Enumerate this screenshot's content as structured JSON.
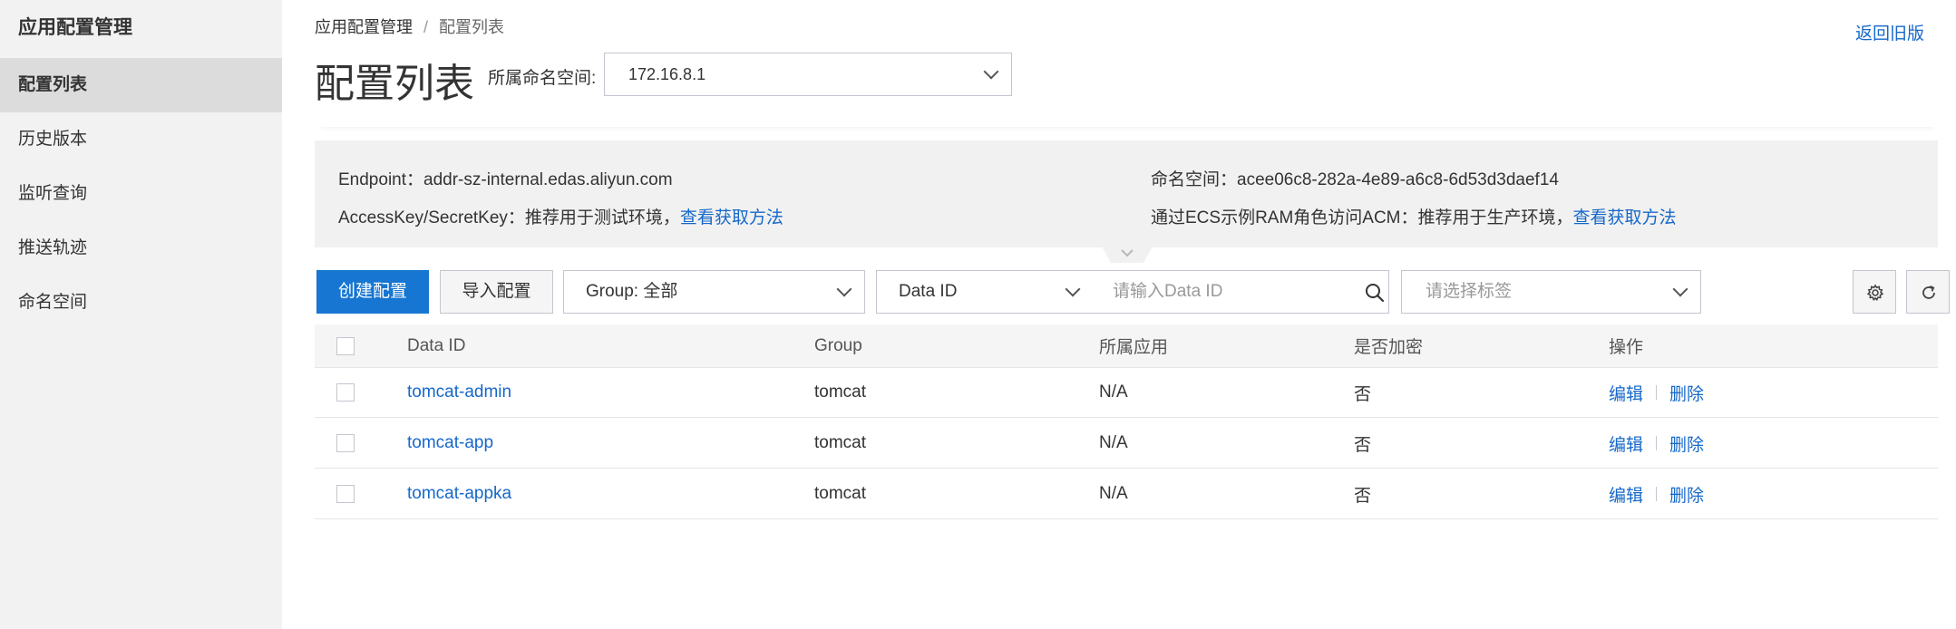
{
  "sidebar": {
    "title": "应用配置管理",
    "items": [
      {
        "label": "配置列表"
      },
      {
        "label": "历史版本"
      },
      {
        "label": "监听查询"
      },
      {
        "label": "推送轨迹"
      },
      {
        "label": "命名空间"
      }
    ]
  },
  "header": {
    "breadcrumb": {
      "root": "应用配置管理",
      "separator": "/",
      "current": "配置列表"
    },
    "back_link": "返回旧版",
    "title": "配置列表",
    "namespace_label": "所属命名空间:",
    "namespace_value": "172.16.8.1"
  },
  "info": {
    "endpoint": "Endpoint：addr-sz-internal.edas.aliyun.com",
    "namespace": "命名空间：acee06c8-282a-4e89-a6c8-6d53d3daef14",
    "accesskey_text": "AccessKey/SecretKey：推荐用于测试环境，",
    "accesskey_link": "查看获取方法",
    "ecs_text": "通过ECS示例RAM角色访问ACM：推荐用于生产环境，",
    "ecs_link": "查看获取方法"
  },
  "toolbar": {
    "create_label": "创建配置",
    "import_label": "导入配置",
    "group_select": "Group: 全部",
    "field_select": "Data ID",
    "search_placeholder": "请输入Data ID",
    "tag_placeholder": "请选择标签"
  },
  "table": {
    "columns": [
      "Data ID",
      "Group",
      "所属应用",
      "是否加密",
      "操作"
    ],
    "rows": [
      {
        "data_id": "tomcat-admin",
        "group": "tomcat",
        "app": "N/A",
        "encrypted": "否",
        "edit": "编辑",
        "delete": "删除"
      },
      {
        "data_id": "tomcat-app",
        "group": "tomcat",
        "app": "N/A",
        "encrypted": "否",
        "edit": "编辑",
        "delete": "删除"
      },
      {
        "data_id": "tomcat-appka",
        "group": "tomcat",
        "app": "N/A",
        "encrypted": "否",
        "edit": "编辑",
        "delete": "删除"
      }
    ]
  },
  "icons": {
    "search": "search-icon",
    "settings": "gear-icon",
    "refresh": "refresh-icon",
    "dropdown": "chevron-down-icon",
    "collapse": "collapse-tab-icon"
  },
  "colors": {
    "accent": "#1676d2",
    "link": "#1668c9",
    "sidebar_bg": "#f2f2f2",
    "sidebar_active": "#dcdcdc",
    "panel_bg": "#f1f1f1"
  }
}
